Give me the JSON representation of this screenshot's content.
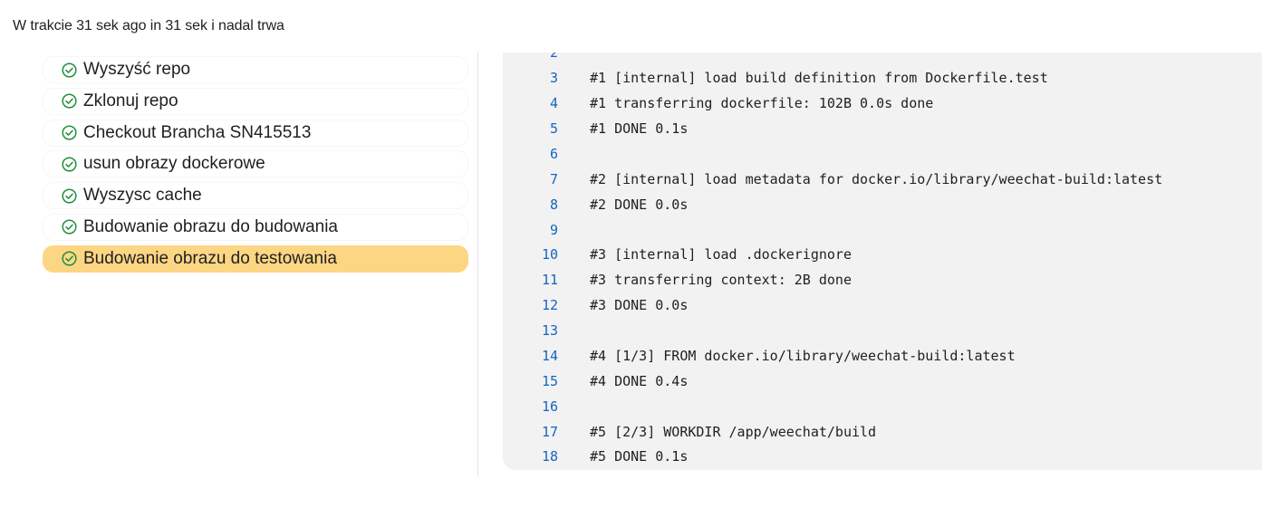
{
  "status": {
    "text": "W trakcie 31 sek ago in 31 sek i nadal trwa"
  },
  "steps": [
    {
      "label": "Wyszyść repo",
      "state": "success"
    },
    {
      "label": "Zklonuj repo",
      "state": "success"
    },
    {
      "label": "Checkout Brancha SN415513",
      "state": "success"
    },
    {
      "label": "usun obrazy dockerowe",
      "state": "success"
    },
    {
      "label": "Wyszysc cache",
      "state": "success"
    },
    {
      "label": "Budowanie obrazu do budowania",
      "state": "success"
    },
    {
      "label": "Budowanie obrazu do testowania",
      "state": "success",
      "selected": true
    }
  ],
  "log": {
    "lines": [
      {
        "no": "2",
        "text": ""
      },
      {
        "no": "3",
        "text": "#1 [internal] load build definition from Dockerfile.test"
      },
      {
        "no": "4",
        "text": "#1 transferring dockerfile: 102B 0.0s done"
      },
      {
        "no": "5",
        "text": "#1 DONE 0.1s"
      },
      {
        "no": "6",
        "text": ""
      },
      {
        "no": "7",
        "text": "#2 [internal] load metadata for docker.io/library/weechat-build:latest"
      },
      {
        "no": "8",
        "text": "#2 DONE 0.0s"
      },
      {
        "no": "9",
        "text": ""
      },
      {
        "no": "10",
        "text": "#3 [internal] load .dockerignore"
      },
      {
        "no": "11",
        "text": "#3 transferring context: 2B done"
      },
      {
        "no": "12",
        "text": "#3 DONE 0.0s"
      },
      {
        "no": "13",
        "text": ""
      },
      {
        "no": "14",
        "text": "#4 [1/3] FROM docker.io/library/weechat-build:latest"
      },
      {
        "no": "15",
        "text": "#4 DONE 0.4s"
      },
      {
        "no": "16",
        "text": ""
      },
      {
        "no": "17",
        "text": "#5 [2/3] WORKDIR /app/weechat/build"
      },
      {
        "no": "18",
        "text": "#5 DONE 0.1s"
      }
    ]
  },
  "colors": {
    "success": "#1e8e3e",
    "selected_bg": "#fdd684",
    "line_number": "#1565c0",
    "console_bg": "#f2f2f2"
  }
}
